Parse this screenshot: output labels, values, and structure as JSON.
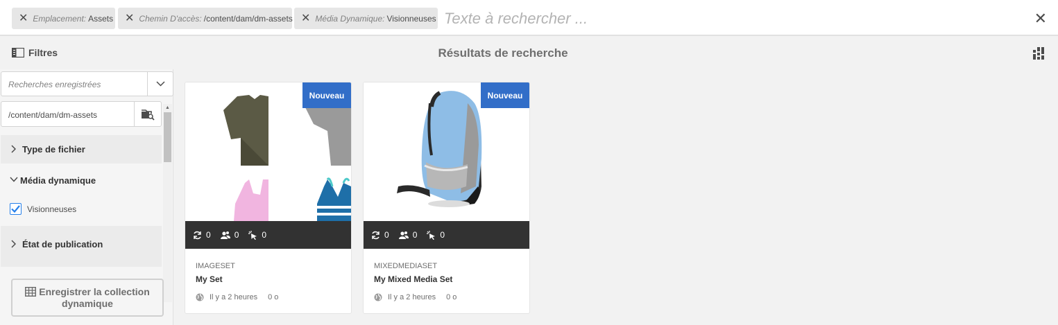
{
  "search": {
    "tags": [
      {
        "key": "Emplacement:",
        "value": "Assets"
      },
      {
        "key": "Chemin D'accès:",
        "value": "/content/dam/dm-assets"
      },
      {
        "key": "Média Dynamique:",
        "value": "Visionneuses"
      }
    ],
    "placeholder": "Texte à rechercher ..."
  },
  "header": {
    "filters_label": "Filtres",
    "title": "Résultats de recherche"
  },
  "rail": {
    "saved_searches_placeholder": "Recherches enregistrées",
    "path_value": "/content/dam/dm-assets",
    "sections": {
      "file_type": "Type de fichier",
      "dynamic_media": "Média dynamique",
      "viewers_option": "Visionneuses",
      "publish_state": "État de publication"
    },
    "viewers_checked": true,
    "save_button": {
      "line1": "Enregistrer la collection",
      "line2": "dynamique"
    }
  },
  "cards": [
    {
      "badge": "Nouveau",
      "type": "IMAGESET",
      "name": "My Set",
      "time": "Il y a 2 heures",
      "size": "0 o",
      "stats": {
        "refresh": "0",
        "users": "0",
        "clicks": "0"
      }
    },
    {
      "badge": "Nouveau",
      "type": "MIXEDMEDIASET",
      "name": "My Mixed Media Set",
      "time": "Il y a 2 heures",
      "size": "0 o",
      "stats": {
        "refresh": "0",
        "users": "0",
        "clicks": "0"
      }
    }
  ],
  "colors": {
    "badge": "#326ec8",
    "stats_bar": "#323232",
    "checkbox": "#2680eb"
  }
}
